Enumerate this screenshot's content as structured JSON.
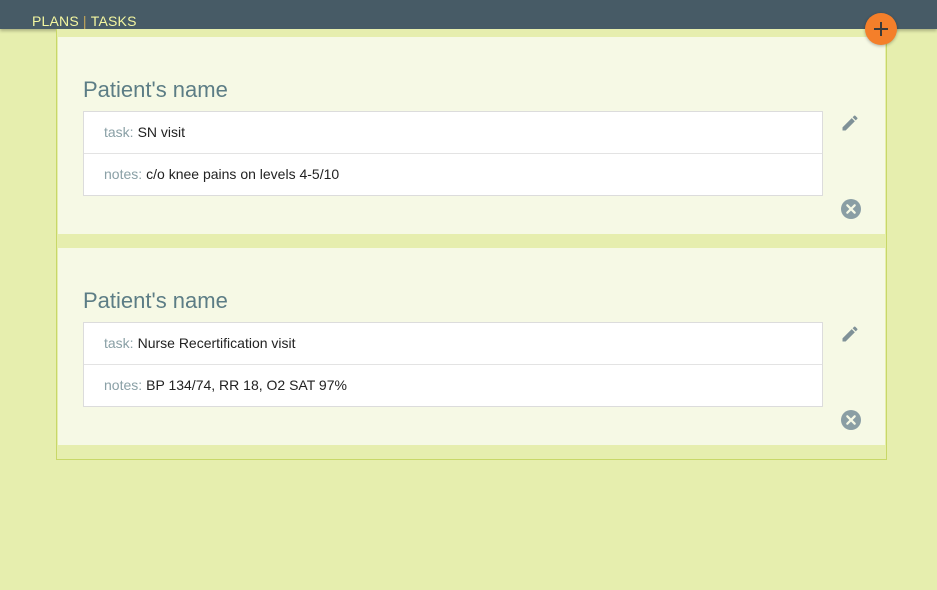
{
  "nav": {
    "plans_label": "PLANS",
    "separator": "|",
    "tasks_label": "TASKS"
  },
  "actions": {
    "add_icon": "plus-icon",
    "edit_icon": "pencil-icon",
    "delete_icon": "close-circle-icon"
  },
  "colors": {
    "topbar": "#475b66",
    "nav_text": "#f3f6a0",
    "accent": "#f47f2a",
    "background": "#e6eeae",
    "card": "#f6f9e5",
    "title": "#5c7d85"
  },
  "tasks": [
    {
      "patient_name": "Patient's name",
      "task_label": "task:",
      "task_value": "SN visit",
      "notes_label": "notes:",
      "notes_value": "c/o knee pains on levels 4-5/10"
    },
    {
      "patient_name": "Patient's name",
      "task_label": "task:",
      "task_value": "Nurse Recertification visit",
      "notes_label": "notes:",
      "notes_value": "BP 134/74, RR 18, O2 SAT 97%"
    }
  ]
}
